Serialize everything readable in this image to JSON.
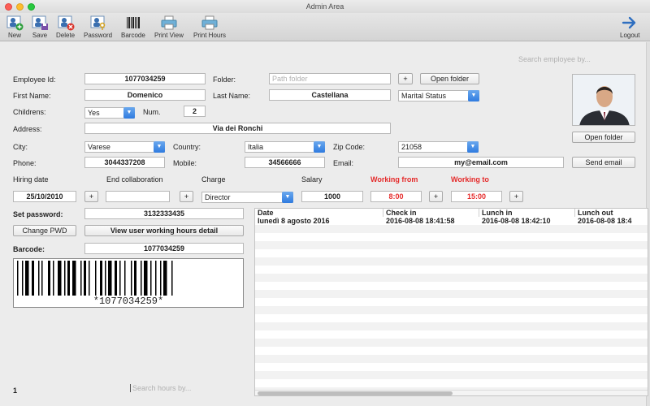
{
  "window": {
    "title": "Admin Area"
  },
  "toolbar": {
    "new_label": "New",
    "save_label": "Save",
    "delete_label": "Delete",
    "password_label": "Password",
    "barcode_label": "Barcode",
    "print_view_label": "Print View",
    "print_hours_label": "Print Hours",
    "logout_label": "Logout"
  },
  "search": {
    "employee_placeholder": "Search employee by...",
    "hours_placeholder": "Search hours by..."
  },
  "form": {
    "employee_id_label": "Employee Id:",
    "employee_id": "1077034259",
    "folder_label": "Folder:",
    "folder_placeholder": "Path folder",
    "plus": "+",
    "open_folder_label": "Open folder",
    "first_name_label": "First Name:",
    "first_name": "Domenico",
    "last_name_label": "Last Name:",
    "last_name": "Castellana",
    "marital_status": "Marital Status",
    "childrens_label": "Childrens:",
    "childrens": "Yes",
    "num_label": "Num.",
    "num": "2",
    "address_label": "Address:",
    "address": "Via dei Ronchi",
    "city_label": "City:",
    "city": "Varese",
    "country_label": "Country:",
    "country": "Italia",
    "zip_label": "Zip Code:",
    "zip": "21058",
    "phone_label": "Phone:",
    "phone": "3044337208",
    "mobile_label": "Mobile:",
    "mobile": "34566666",
    "email_label": "Email:",
    "email": "my@email.com",
    "send_email_label": "Send email",
    "hiring_label": "Hiring date",
    "hiring_date": "25/10/2010",
    "end_collab_label": "End collaboration",
    "charge_label": "Charge",
    "charge": "Director",
    "salary_label": "Salary",
    "salary": "1000",
    "working_from_label": "Working from",
    "working_from": "8:00",
    "working_to_label": "Working to",
    "working_to": "15:00",
    "set_password_label": "Set password:",
    "password": "3132333435",
    "change_pwd_label": "Change PWD",
    "view_hours_label": "View user working hours detail",
    "barcode_label": "Barcode:",
    "barcode_value": "1077034259",
    "barcode_text": "*1077034259*",
    "photo_open_folder_label": "Open folder"
  },
  "table": {
    "columns": [
      "Date",
      "Check in",
      "Lunch in",
      "Lunch out"
    ],
    "rows": [
      [
        "lunedì 8 agosto 2016",
        "2016-08-08 18:41:58",
        "2016-08-08 18:42:10",
        "2016-08-08 18:4"
      ]
    ]
  },
  "footer": {
    "page_number": "1"
  },
  "colors": {
    "accent": "#2f7be0",
    "red_label": "#e52a2a"
  }
}
